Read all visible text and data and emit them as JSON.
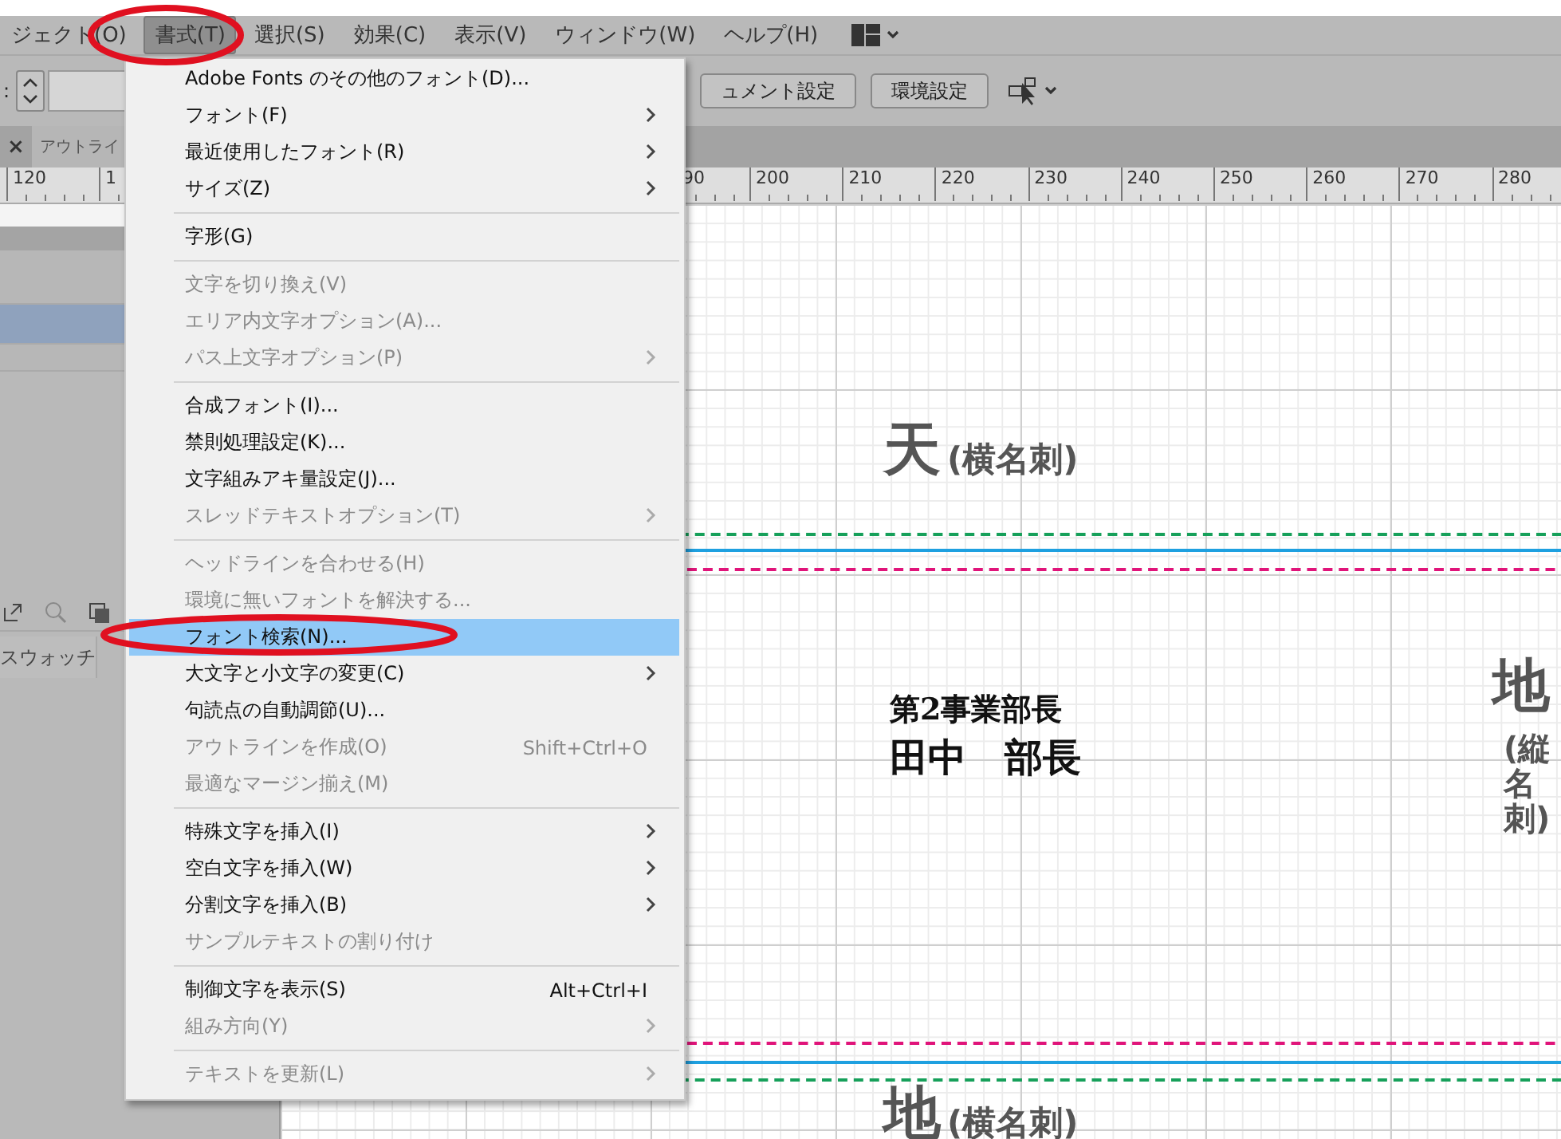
{
  "menubar": {
    "items": [
      {
        "label": "ジェクト(O)",
        "selected": false
      },
      {
        "label": "書式(T)",
        "selected": true
      },
      {
        "label": "選択(S)",
        "selected": false
      },
      {
        "label": "効果(C)",
        "selected": false
      },
      {
        "label": "表示(V)",
        "selected": false
      },
      {
        "label": "ウィンドウ(W)",
        "selected": false
      },
      {
        "label": "ヘルプ(H)",
        "selected": false
      }
    ]
  },
  "controlbar": {
    "label": ":",
    "buttons": [
      "ュメント設定",
      "環境設定"
    ]
  },
  "tabbar": {
    "close": "×",
    "tab": "アウトライ"
  },
  "ruler": {
    "left_labels": [
      "120",
      "1"
    ],
    "right_labels": [
      "90",
      "200",
      "210",
      "220",
      "230",
      "240",
      "250",
      "260",
      "270",
      "280"
    ]
  },
  "panel": {
    "rows": [
      {
        "selected": false
      },
      {
        "selected": true
      },
      {
        "selected": false
      }
    ],
    "tab": "スウォッチ"
  },
  "menu": {
    "items": [
      {
        "kind": "item",
        "label": "Adobe Fonts のその他のフォント(D)...",
        "disabled": false,
        "submenu": false,
        "selected": false
      },
      {
        "kind": "item",
        "label": "フォント(F)",
        "disabled": false,
        "submenu": true,
        "selected": false
      },
      {
        "kind": "item",
        "label": "最近使用したフォント(R)",
        "disabled": false,
        "submenu": true,
        "selected": false
      },
      {
        "kind": "item",
        "label": "サイズ(Z)",
        "disabled": false,
        "submenu": true,
        "selected": false
      },
      {
        "kind": "separator"
      },
      {
        "kind": "item",
        "label": "字形(G)",
        "disabled": false,
        "submenu": false,
        "selected": false
      },
      {
        "kind": "separator"
      },
      {
        "kind": "item",
        "label": "文字を切り換え(V)",
        "disabled": true,
        "submenu": false,
        "selected": false
      },
      {
        "kind": "item",
        "label": "エリア内文字オプション(A)...",
        "disabled": true,
        "submenu": false,
        "selected": false
      },
      {
        "kind": "item",
        "label": "パス上文字オプション(P)",
        "disabled": true,
        "submenu": true,
        "selected": false
      },
      {
        "kind": "separator"
      },
      {
        "kind": "item",
        "label": "合成フォント(I)...",
        "disabled": false,
        "submenu": false,
        "selected": false
      },
      {
        "kind": "item",
        "label": "禁則処理設定(K)...",
        "disabled": false,
        "submenu": false,
        "selected": false
      },
      {
        "kind": "item",
        "label": "文字組みアキ量設定(J)...",
        "disabled": false,
        "submenu": false,
        "selected": false
      },
      {
        "kind": "item",
        "label": "スレッドテキストオプション(T)",
        "disabled": true,
        "submenu": true,
        "selected": false
      },
      {
        "kind": "separator"
      },
      {
        "kind": "item",
        "label": "ヘッドラインを合わせる(H)",
        "disabled": true,
        "submenu": false,
        "selected": false
      },
      {
        "kind": "item",
        "label": "環境に無いフォントを解決する...",
        "disabled": true,
        "submenu": false,
        "selected": false
      },
      {
        "kind": "item",
        "label": "フォント検索(N)...",
        "disabled": false,
        "submenu": false,
        "selected": true
      },
      {
        "kind": "item",
        "label": "大文字と小文字の変更(C)",
        "disabled": false,
        "submenu": true,
        "selected": false
      },
      {
        "kind": "item",
        "label": "句読点の自動調節(U)...",
        "disabled": false,
        "submenu": false,
        "selected": false
      },
      {
        "kind": "item",
        "label": "アウトラインを作成(O)",
        "disabled": true,
        "submenu": false,
        "selected": false,
        "shortcut": "Shift+Ctrl+O"
      },
      {
        "kind": "item",
        "label": "最適なマージン揃え(M)",
        "disabled": true,
        "submenu": false,
        "selected": false
      },
      {
        "kind": "separator"
      },
      {
        "kind": "item",
        "label": "特殊文字を挿入(I)",
        "disabled": false,
        "submenu": true,
        "selected": false
      },
      {
        "kind": "item",
        "label": "空白文字を挿入(W)",
        "disabled": false,
        "submenu": true,
        "selected": false
      },
      {
        "kind": "item",
        "label": "分割文字を挿入(B)",
        "disabled": false,
        "submenu": true,
        "selected": false
      },
      {
        "kind": "item",
        "label": "サンプルテキストの割り付け",
        "disabled": true,
        "submenu": false,
        "selected": false
      },
      {
        "kind": "separator"
      },
      {
        "kind": "item",
        "label": "制御文字を表示(S)",
        "disabled": false,
        "submenu": false,
        "selected": false,
        "shortcut": "Alt+Ctrl+I"
      },
      {
        "kind": "item",
        "label": "組み方向(Y)",
        "disabled": true,
        "submenu": true,
        "selected": false
      },
      {
        "kind": "separator"
      },
      {
        "kind": "item",
        "label": "テキストを更新(L)",
        "disabled": true,
        "submenu": true,
        "selected": false
      }
    ]
  },
  "artboard": {
    "top_label": {
      "main": "天",
      "note": "(横名刺)"
    },
    "card_lines": [
      "第2事業部長",
      "田中　部長"
    ],
    "side_label": {
      "main": "地",
      "note": "(縦名刺)"
    },
    "bottom_label": {
      "main": "地",
      "note": "(横名刺)"
    }
  }
}
